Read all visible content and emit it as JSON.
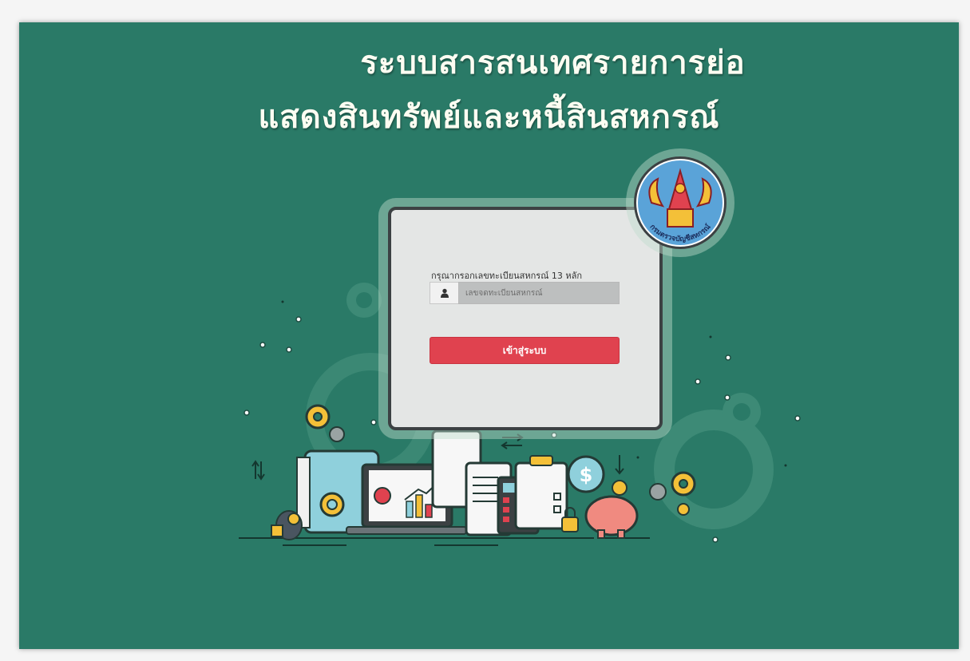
{
  "header": {
    "title_line1": "ระบบสารสนเทศรายการย่อ",
    "title_line2": "แสดงสินทรัพย์และหนี้สินสหกรณ์"
  },
  "login": {
    "prompt": "กรุณากรอกเลขทะเบียนสหกรณ์ 13 หลัก",
    "input_placeholder": "เลขจดทะเบียนสหกรณ์",
    "input_icon": "user-icon",
    "submit_label": "เข้าสู่ระบบ"
  },
  "logo": {
    "text": "กรมตรวจบัญชีสหกรณ์"
  },
  "colors": {
    "background": "#2a7a67",
    "button": "#e0424f",
    "card": "#e4e6e5"
  }
}
